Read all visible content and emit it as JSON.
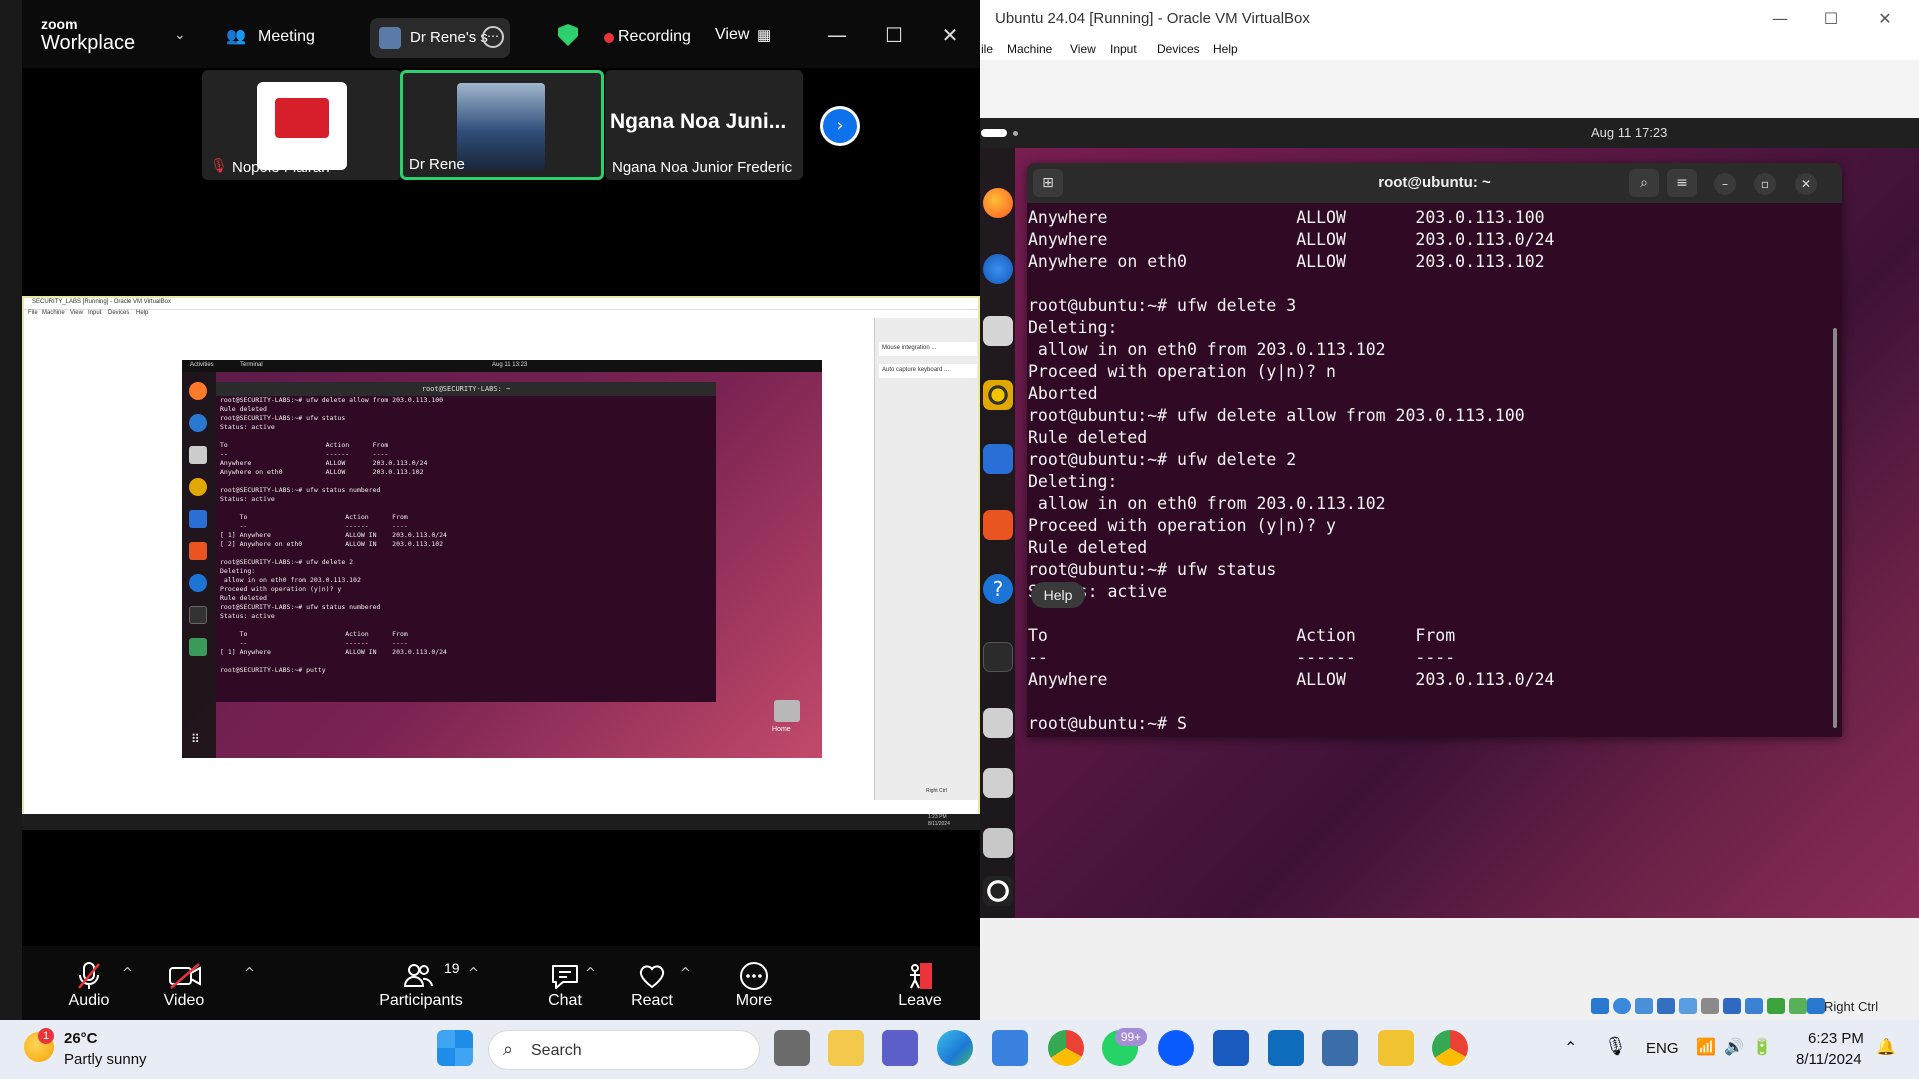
{
  "zoom": {
    "brand_top": "zoom",
    "brand_bottom": "Workplace",
    "meeting_label": "Meeting",
    "sharer_label": "Dr Rene's s",
    "recording_label": "Recording",
    "view_label": "View",
    "participants_tiles": [
      {
        "name": "Nopole Flairan",
        "muted": true
      },
      {
        "name": "Dr Rene",
        "active_speaker": true
      },
      {
        "name": "Ngana Noa Junior Frederic",
        "heading": "Ngana Noa Juni..."
      }
    ],
    "toolbar": {
      "audio": "Audio",
      "video": "Video",
      "participants": "Participants",
      "participants_count": "19",
      "chat": "Chat",
      "react": "React",
      "more": "More",
      "leave": "Leave"
    },
    "shared_screen": {
      "window_title": "SECURITY_LABS [Running] - Oracle VM VirtualBox",
      "menu": [
        "File",
        "Machine",
        "View",
        "Input",
        "Devices",
        "Help"
      ],
      "activities": "Activities",
      "terminal_app": "Terminal",
      "clock": "Aug 11 13:23",
      "terminal_title": "root@SECURITY-LABS: ~",
      "home_label": "Home",
      "side_items": [
        "Mouse integration ...",
        "Auto capture keyboard ..."
      ],
      "lines": [
        "root@SECURITY-LABS:~# ufw delete allow from 203.0.113.100",
        "Rule deleted",
        "root@SECURITY-LABS:~# ufw status",
        "Status: active",
        "",
        "To                         Action      From",
        "--                         ------      ----",
        "Anywhere                   ALLOW       203.0.113.0/24",
        "Anywhere on eth0           ALLOW       203.0.113.102",
        "",
        "root@SECURITY-LABS:~# ufw status numbered",
        "Status: active",
        "",
        "     To                         Action      From",
        "     --                         ------      ----",
        "[ 1] Anywhere                   ALLOW IN    203.0.113.0/24",
        "[ 2] Anywhere on eth0           ALLOW IN    203.0.113.102",
        "",
        "root@SECURITY-LABS:~# ufw delete 2",
        "Deleting:",
        " allow in on eth0 from 203.0.113.102",
        "Proceed with operation (y|n)? y",
        "Rule deleted",
        "root@SECURITY-LABS:~# ufw status numbered",
        "Status: active",
        "",
        "     To                         Action      From",
        "     --                         ------      ----",
        "[ 1] Anywhere                   ALLOW IN    203.0.113.0/24",
        "",
        "root@SECURITY-LABS:~# putty"
      ],
      "tray_time": "1:23 PM",
      "tray_date": "8/11/2024"
    }
  },
  "vbox": {
    "window_title": "Ubuntu 24.04 [Running] - Oracle VM VirtualBox",
    "menu": [
      "ile",
      "Machine",
      "View",
      "Input",
      "Devices",
      "Help"
    ],
    "clock": "Aug 11  17:23",
    "host_key": "Right Ctrl",
    "help_tooltip": "Help",
    "terminal": {
      "title": "root@ubuntu: ~",
      "lines": [
        "Anywhere                   ALLOW       203.0.113.100",
        "Anywhere                   ALLOW       203.0.113.0/24",
        "Anywhere on eth0           ALLOW       203.0.113.102",
        "",
        "root@ubuntu:~# ufw delete 3",
        "Deleting:",
        " allow in on eth0 from 203.0.113.102",
        "Proceed with operation (y|n)? n",
        "Aborted",
        "root@ubuntu:~# ufw delete allow from 203.0.113.100",
        "Rule deleted",
        "root@ubuntu:~# ufw delete 2",
        "Deleting:",
        " allow in on eth0 from 203.0.113.102",
        "Proceed with operation (y|n)? y",
        "Rule deleted",
        "root@ubuntu:~# ufw status",
        "Status: active",
        "",
        "To                         Action      From",
        "--                         ------      ----",
        "Anywhere                   ALLOW       203.0.113.0/24",
        "",
        "root@ubuntu:~# S"
      ]
    }
  },
  "taskbar": {
    "temperature": "26°C",
    "weather": "Partly sunny",
    "weather_badge": "1",
    "search_placeholder": "Search",
    "whatsapp_badge": "99+",
    "language": "ENG",
    "time": "6:23 PM",
    "date": "8/11/2024"
  },
  "colors": {
    "zoom_green": "#2ed06e",
    "recording_red": "#e8343a",
    "terminal_bg": "#300a24",
    "ubuntu_accent": "#e95420",
    "taskbar_bg": "#e8ecf4"
  }
}
